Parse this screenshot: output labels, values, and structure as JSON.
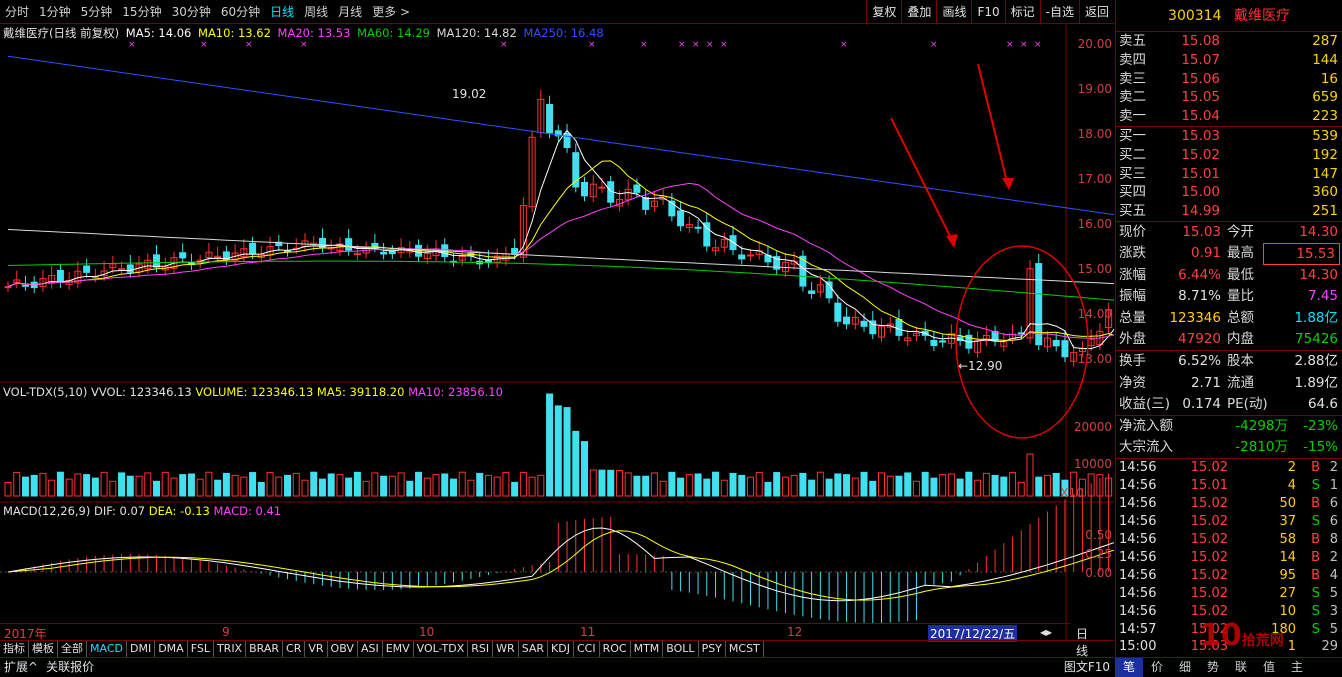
{
  "toolbar": {
    "periods": [
      "分时",
      "1分钟",
      "5分钟",
      "15分钟",
      "30分钟",
      "60分钟",
      "日线",
      "周线",
      "月线",
      "更多 >"
    ],
    "active_period": "日线",
    "buttons": [
      "复权",
      "叠加",
      "画线",
      "F10",
      "标记",
      "-自选",
      "返回"
    ]
  },
  "main_legend": {
    "name": "戴维医疗(日线 前复权)",
    "ma5": "MA5: 14.06",
    "ma10": "MA10: 13.62",
    "ma20": "MA20: 13.53",
    "ma60": "MA60: 14.29",
    "ma120": "MA120: 14.82",
    "ma250": "MA250: 16.48",
    "colors": {
      "ma5": "#ffffff",
      "ma10": "#ffff00",
      "ma20": "#ff40ff",
      "ma60": "#00d000",
      "ma120": "#d8d8d8",
      "ma250": "#3050ff"
    }
  },
  "annotations": {
    "high": "19.02",
    "low": "12.90"
  },
  "vol_legend": {
    "name": "VOL-TDX(5,10)",
    "vvol": "VVOL: 123346.13",
    "volume": "VOLUME: 123346.13",
    "ma5": "MA5: 39118.20",
    "ma10": "MA10: 23856.10"
  },
  "macd_legend": {
    "name": "MACD(12,26,9)",
    "dif": "DIF: 0.07",
    "dea": "DEA: -0.13",
    "macd": "MACD: 0.41"
  },
  "price_axis": [
    "20.00",
    "19.00",
    "18.00",
    "17.00",
    "16.00",
    "15.00",
    "14.00",
    "13.00"
  ],
  "vol_axis": [
    "20000",
    "10000",
    "X10"
  ],
  "macd_axis": [
    "0.50",
    "0.25",
    "0.00"
  ],
  "xaxis": {
    "year": "2017年",
    "m9": "9",
    "m10": "10",
    "m11": "11",
    "m12": "12",
    "current": "2017/12/22/五",
    "right": "日线"
  },
  "tabs": [
    "指标",
    "模板",
    "全部",
    "MACD",
    "DMI",
    "DMA",
    "FSL",
    "TRIX",
    "BRAR",
    "CR",
    "VR",
    "OBV",
    "ASI",
    "EMV",
    "VOL-TDX",
    "RSI",
    "WR",
    "SAR",
    "KDJ",
    "CCI",
    "ROC",
    "MTM",
    "BOLL",
    "PSY",
    "MCST"
  ],
  "active_tab": "MACD",
  "bottom": {
    "expand": "扩展^",
    "related": "关联报价",
    "chart_f10": "图文F10"
  },
  "stock": {
    "code": "300314",
    "name": "戴维医疗"
  },
  "asks": [
    {
      "label": "卖五",
      "price": "15.08",
      "vol": "287"
    },
    {
      "label": "卖四",
      "price": "15.07",
      "vol": "144"
    },
    {
      "label": "卖三",
      "price": "15.06",
      "vol": "16"
    },
    {
      "label": "卖二",
      "price": "15.05",
      "vol": "659"
    },
    {
      "label": "卖一",
      "price": "15.04",
      "vol": "223"
    }
  ],
  "bids": [
    {
      "label": "买一",
      "price": "15.03",
      "vol": "539"
    },
    {
      "label": "买二",
      "price": "15.02",
      "vol": "192"
    },
    {
      "label": "买三",
      "price": "15.01",
      "vol": "147"
    },
    {
      "label": "买四",
      "price": "15.00",
      "vol": "360"
    },
    {
      "label": "买五",
      "price": "14.99",
      "vol": "251"
    }
  ],
  "stats": [
    {
      "l1": "现价",
      "v1": "15.03",
      "l2": "今开",
      "v2": "14.30",
      "c1": "#ff4040",
      "c2": "#ff4040"
    },
    {
      "l1": "涨跌",
      "v1": "0.91",
      "l2": "最高",
      "v2": "15.53",
      "c1": "#ff4040",
      "c2": "#ff4040"
    },
    {
      "l1": "涨幅",
      "v1": "6.44%",
      "l2": "最低",
      "v2": "14.30",
      "c1": "#ff4040",
      "c2": "#ff4040"
    },
    {
      "l1": "振幅",
      "v1": "8.71%",
      "l2": "量比",
      "v2": "7.45",
      "c1": "#e0e0e0",
      "c2": "#ff40ff"
    },
    {
      "l1": "总量",
      "v1": "123346",
      "l2": "总额",
      "v2": "1.88亿",
      "c1": "#ffd000",
      "c2": "#00e5ff"
    },
    {
      "l1": "外盘",
      "v1": "47920",
      "l2": "内盘",
      "v2": "75426",
      "c1": "#ff4040",
      "c2": "#00d000"
    }
  ],
  "stats2": [
    {
      "l1": "换手",
      "v1": "6.52%",
      "l2": "股本",
      "v2": "2.88亿"
    },
    {
      "l1": "净资",
      "v1": "2.71",
      "l2": "流通",
      "v2": "1.89亿"
    },
    {
      "l1": "收益(三)",
      "v1": "0.174",
      "l2": "PE(动)",
      "v2": "64.6"
    }
  ],
  "flows": [
    {
      "label": "净流入额",
      "value": "-4298万",
      "pct": "-23%"
    },
    {
      "label": "大宗流入",
      "value": "-2810万",
      "pct": "-15%"
    }
  ],
  "ticks": [
    {
      "t": "14:56",
      "p": "15.02",
      "v": "2",
      "d": "B",
      "n": "2"
    },
    {
      "t": "14:56",
      "p": "15.01",
      "v": "4",
      "d": "S",
      "n": "1"
    },
    {
      "t": "14:56",
      "p": "15.02",
      "v": "50",
      "d": "B",
      "n": "6"
    },
    {
      "t": "14:56",
      "p": "15.02",
      "v": "37",
      "d": "S",
      "n": "6"
    },
    {
      "t": "14:56",
      "p": "15.02",
      "v": "58",
      "d": "B",
      "n": "8"
    },
    {
      "t": "14:56",
      "p": "15.02",
      "v": "14",
      "d": "B",
      "n": "2"
    },
    {
      "t": "14:56",
      "p": "15.02",
      "v": "95",
      "d": "B",
      "n": "4"
    },
    {
      "t": "14:56",
      "p": "15.02",
      "v": "27",
      "d": "S",
      "n": "5"
    },
    {
      "t": "14:56",
      "p": "15.02",
      "v": "10",
      "d": "S",
      "n": "3"
    },
    {
      "t": "14:57",
      "p": "15.02",
      "v": "180",
      "d": "S",
      "n": "5"
    },
    {
      "t": "15:00",
      "p": "15.03",
      "v": "1",
      "d": "",
      "n": "29"
    }
  ],
  "right_tabs": [
    "笔",
    "价",
    "细",
    "势",
    "联",
    "值",
    "主"
  ],
  "watermark": {
    "main": "10",
    "sub": "拾荒网",
    "domain": "Huang.cn"
  }
}
